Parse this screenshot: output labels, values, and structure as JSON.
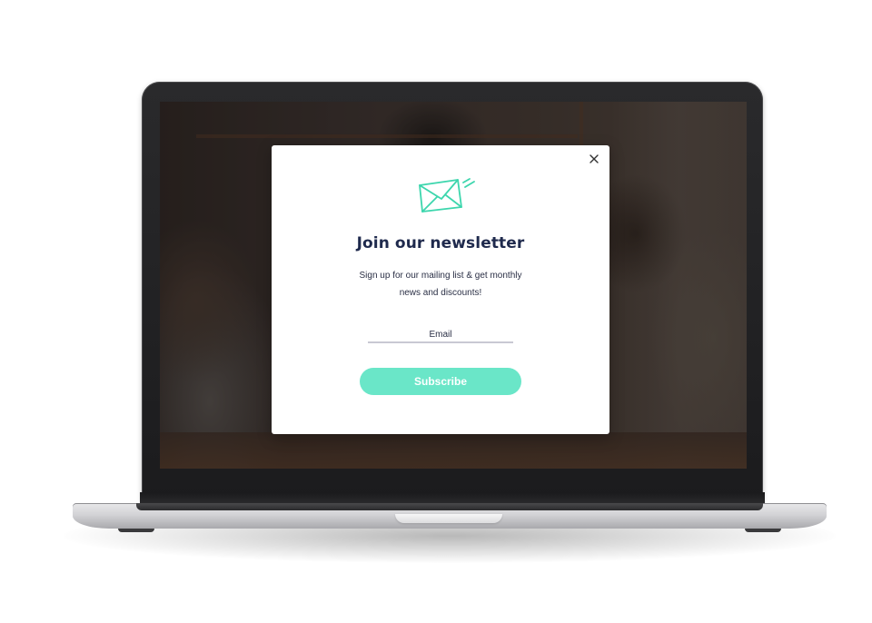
{
  "modal": {
    "title": "Join our newsletter",
    "description": "Sign up for our mailing list & get monthly news and discounts!",
    "email_placeholder": "Email",
    "email_value": "",
    "subscribe_label": "Subscribe",
    "icons": {
      "close": "close-icon",
      "envelope": "envelope-icon"
    },
    "colors": {
      "accent": "#6ae6c8",
      "title": "#1f2a4d",
      "text": "#2a2f45",
      "field_underline": "#c9c9d3",
      "envelope_stroke": "#3dd6ad"
    }
  }
}
